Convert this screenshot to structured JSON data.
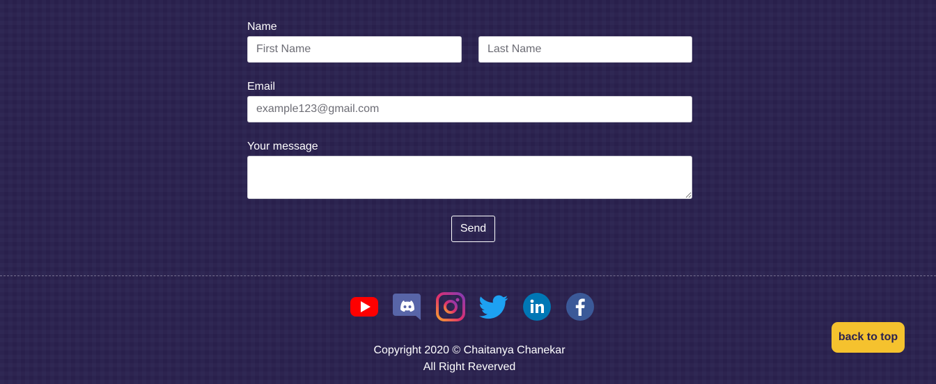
{
  "contact_form": {
    "name_label": "Name",
    "first_name": {
      "placeholder": "First Name",
      "value": ""
    },
    "last_name": {
      "placeholder": "Last Name",
      "value": ""
    },
    "email_label": "Email",
    "email": {
      "placeholder": "example123@gmail.com",
      "value": ""
    },
    "message_label": "Your message",
    "message": {
      "value": ""
    },
    "send_label": "Send"
  },
  "footer": {
    "socials": [
      {
        "icon": "youtube-icon",
        "color": "#ff0000"
      },
      {
        "icon": "discord-icon",
        "color": "#5865a8"
      },
      {
        "icon": "instagram-icon",
        "color": "#c13584"
      },
      {
        "icon": "twitter-icon",
        "color": "#1da1f2"
      },
      {
        "icon": "linkedin-icon",
        "color": "#0077b5"
      },
      {
        "icon": "facebook-icon",
        "color": "#3b5998"
      }
    ],
    "copyright_line1": "Copyright 2020 © Chaitanya Chanekar",
    "copyright_line2": "All Right Reverved",
    "back_to_top": "back to top"
  },
  "colors": {
    "background": "#2b2250",
    "accent": "#f5c22e",
    "text": "#ffffff"
  }
}
